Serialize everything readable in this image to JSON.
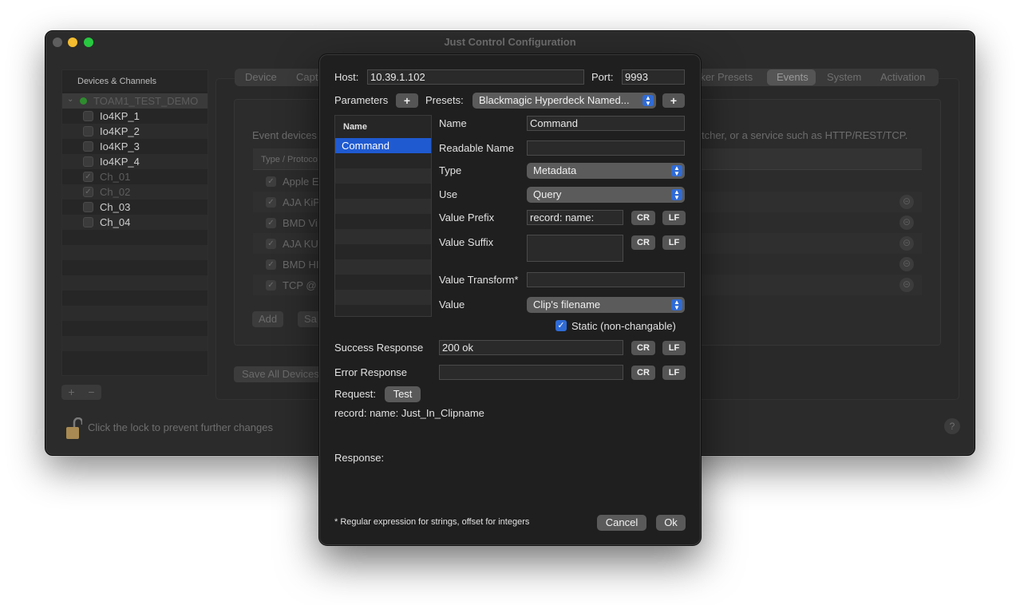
{
  "main_window": {
    "title": "Just Control Configuration",
    "sidebar": {
      "header": "Devices & Channels",
      "root": "TOAM1_TEST_DEMO",
      "items": [
        {
          "label": "Io4KP_1",
          "checked": false,
          "dim": false
        },
        {
          "label": "Io4KP_2",
          "checked": false,
          "dim": false
        },
        {
          "label": "Io4KP_3",
          "checked": false,
          "dim": false
        },
        {
          "label": "Io4KP_4",
          "checked": false,
          "dim": false
        },
        {
          "label": "Ch_01",
          "checked": true,
          "dim": true
        },
        {
          "label": "Ch_02",
          "checked": true,
          "dim": true
        },
        {
          "label": "Ch_03",
          "checked": false,
          "dim": false
        },
        {
          "label": "Ch_04",
          "checked": false,
          "dim": false
        }
      ],
      "add_label": "+",
      "remove_label": "−"
    },
    "tabs": [
      "Device",
      "Capt",
      "rker Presets",
      "Events",
      "System",
      "Activation"
    ],
    "selected_tab": "Events",
    "event_desc_left": "Event devices",
    "event_desc_right": "tcher, or a service such as HTTP/REST/TCP.",
    "table_header": "Type / Protoco",
    "rows": [
      "Apple E",
      "AJA KiP",
      "BMD Vi",
      "AJA KU",
      "BMD HI",
      "TCP @"
    ],
    "add_button": "Add",
    "save_button_partial": "Sa",
    "save_all_button": "Save All Devices",
    "lock_text": "Click the lock to prevent further changes",
    "help_label": "?"
  },
  "dialog": {
    "host_label": "Host:",
    "host_value": "10.39.1.102",
    "port_label": "Port:",
    "port_value": "9993",
    "parameters_label": "Parameters",
    "plus": "+",
    "presets_label": "Presets:",
    "presets_value": "Blackmagic Hyperdeck Named...",
    "list_header": "Name",
    "list_selected": "Command",
    "name_label": "Name",
    "name_value": "Command",
    "readable_name_label": "Readable Name",
    "readable_name_value": "",
    "type_label": "Type",
    "type_value": "Metadata",
    "use_label": "Use",
    "use_value": "Query",
    "value_prefix_label": "Value Prefix",
    "value_prefix_value": "record: name:",
    "value_suffix_label": "Value Suffix",
    "value_suffix_value": "",
    "value_transform_label": "Value Transform*",
    "value_transform_value": "",
    "value_label": "Value",
    "value_value": "Clip's filename",
    "static_label": "Static (non-changable)",
    "static_checked": true,
    "success_label": "Success Response",
    "success_value": "200 ok",
    "error_label": "Error Response",
    "error_value": "",
    "cr": "CR",
    "lf": "LF",
    "request_label": "Request:",
    "test_button": "Test",
    "request_text": "record: name: Just_In_Clipname",
    "response_label": "Response:",
    "footnote": "* Regular expression for strings, offset for integers",
    "cancel_button": "Cancel",
    "ok_button": "Ok"
  },
  "colors": {
    "accent": "#1f5ad1",
    "select_arrow": "#2f6bd6",
    "window_bg": "#2b2b2b",
    "dialog_bg": "#1f1f1f"
  }
}
